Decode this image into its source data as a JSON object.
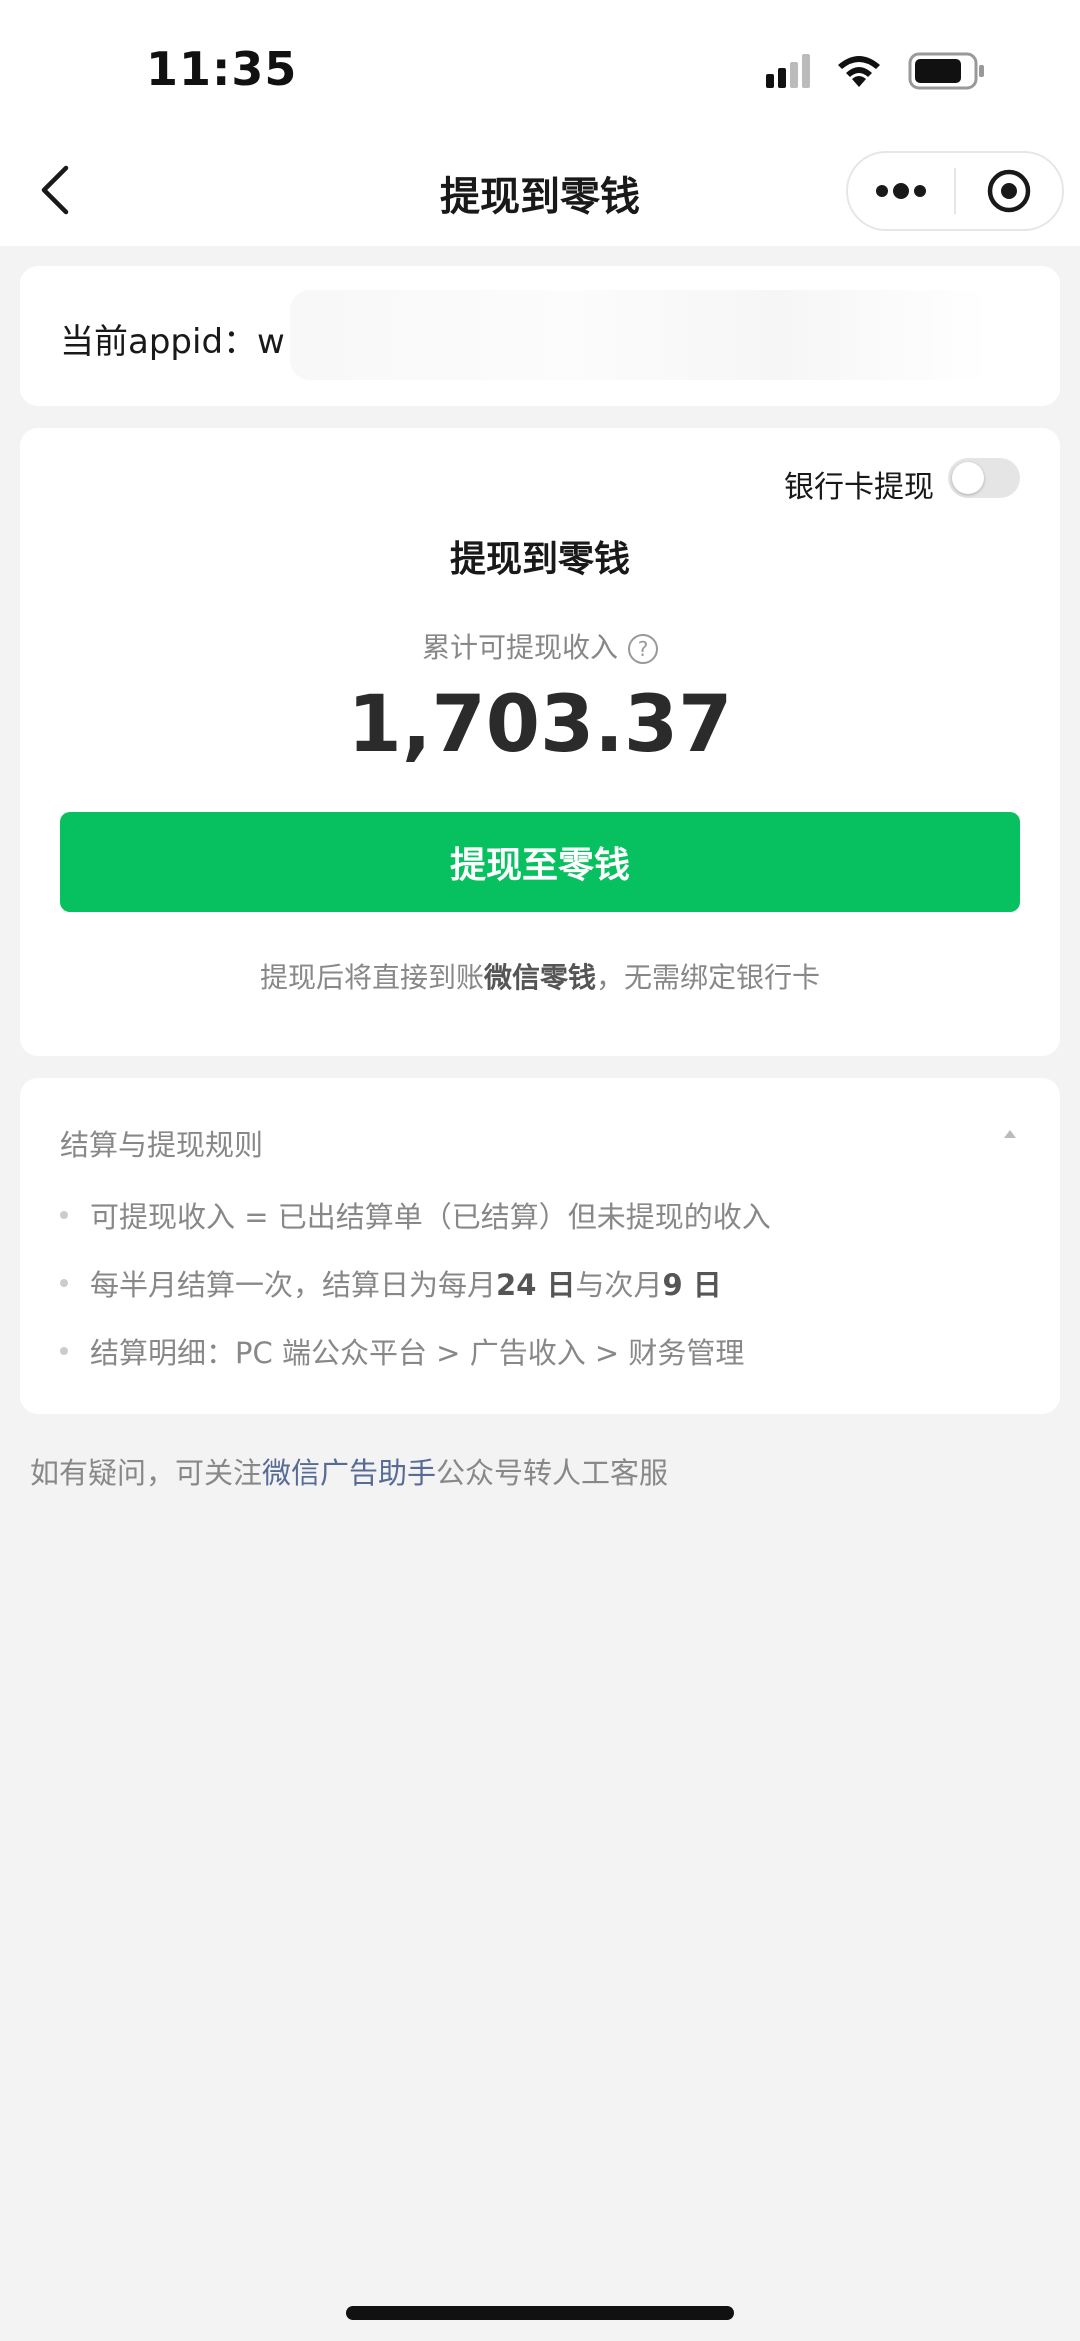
{
  "status_bar": {
    "time": "11:35"
  },
  "nav": {
    "title": "提现到零钱"
  },
  "appid": {
    "label": "当前appid：",
    "value": "w"
  },
  "withdraw": {
    "bank_toggle_label": "银行卡提现",
    "bank_toggle_on": false,
    "title": "提现到零钱",
    "income_label": "累计可提现收入",
    "amount": "1,703.37",
    "button_label": "提现至零钱",
    "tip_prefix": "提现后将直接到账",
    "tip_bold": "微信零钱",
    "tip_suffix": "，无需绑定银行卡"
  },
  "rules": {
    "title": "结算与提现规则",
    "item1": "可提现收入 = 已出结算单（已结算）但未提现的收入",
    "item2_prefix": "每半月结算一次，结算日为每月",
    "item2_bold1": "24 日",
    "item2_mid": "与次月",
    "item2_bold2": "9 日",
    "item3": "结算明细：PC 端公众平台 > 广告收入 > 财务管理"
  },
  "footer": {
    "prefix": "如有疑问，可关注",
    "link": "微信广告助手",
    "suffix": "公众号转人工客服"
  },
  "colors": {
    "accent_green": "#07c160",
    "link_blue": "#576b95",
    "background": "#f3f3f3"
  }
}
